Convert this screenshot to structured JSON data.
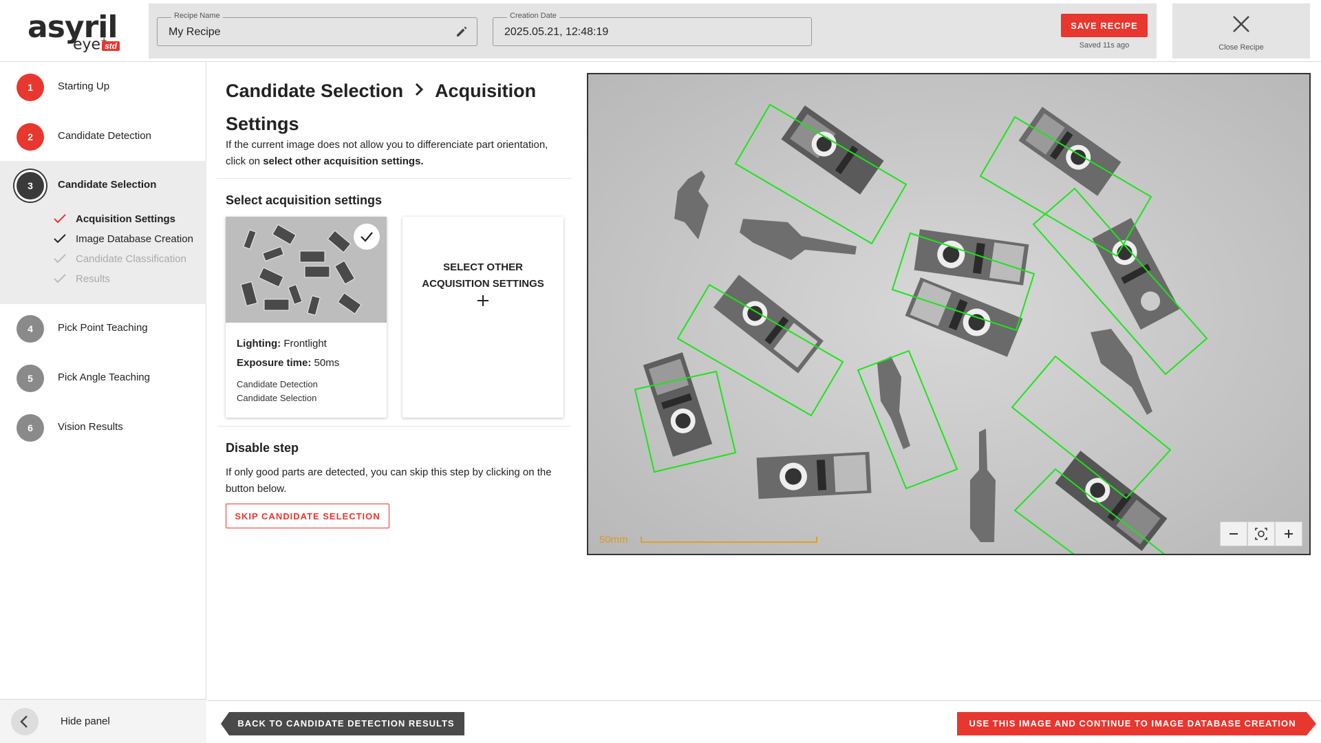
{
  "app": {
    "logo_main": "asyril",
    "logo_sub": "eye",
    "logo_sup": "+",
    "logo_badge": "std"
  },
  "header": {
    "recipe_name_label": "Recipe Name",
    "recipe_name_value": "My Recipe",
    "creation_date_label": "Creation Date",
    "creation_date_value": "2025.05.21, 12:48:19",
    "save_label": "SAVE RECIPE",
    "saved_status": "Saved 11s ago",
    "close_label": "Close Recipe"
  },
  "sidebar": {
    "steps": [
      {
        "num": "1",
        "label": "Starting Up"
      },
      {
        "num": "2",
        "label": "Candidate Detection"
      },
      {
        "num": "3",
        "label": "Candidate Selection"
      },
      {
        "num": "4",
        "label": "Pick Point Teaching"
      },
      {
        "num": "5",
        "label": "Pick Angle Teaching"
      },
      {
        "num": "6",
        "label": "Vision Results"
      }
    ],
    "substeps": [
      {
        "label": "Acquisition Settings"
      },
      {
        "label": "Image Database Creation"
      },
      {
        "label": "Candidate Classification"
      },
      {
        "label": "Results"
      }
    ],
    "hide_panel": "Hide panel"
  },
  "main": {
    "title_part1": "Candidate Selection",
    "title_part2": "Acquisition Settings",
    "intro_text": "If the current image does not allow you to differenciate part orientation, click on ",
    "intro_bold": "select other acquisition settings.",
    "select_heading": "Select acquisition settings",
    "card": {
      "lighting_label": "Lighting:",
      "lighting_value": "Frontlight",
      "exposure_label": "Exposure time:",
      "exposure_value": "50ms",
      "used_in_1": "Candidate Detection",
      "used_in_2": "Candidate Selection"
    },
    "other_settings_label": "SELECT OTHER ACQUISITION SETTINGS",
    "disable_heading": "Disable step",
    "disable_text": "If only good parts are detected, you can skip this step by clicking on the button below.",
    "skip_label": "SKIP CANDIDATE SELECTION"
  },
  "viewer": {
    "scale_label": "50mm"
  },
  "footer": {
    "back_label": "BACK TO CANDIDATE DETECTION RESULTS",
    "next_label": "USE THIS IMAGE AND CONTINUE TO IMAGE DATABASE CREATION"
  },
  "colors": {
    "accent": "#e8372f",
    "detection_box": "#19e619",
    "scale_bar": "#e0a020",
    "dark_button": "#4a4a4a"
  },
  "icons": [
    "pencil-icon",
    "close-icon",
    "checkmark-icon",
    "chevron-right-icon",
    "chevron-left-icon",
    "plus-icon",
    "minus-icon",
    "zoom-fit-icon"
  ]
}
